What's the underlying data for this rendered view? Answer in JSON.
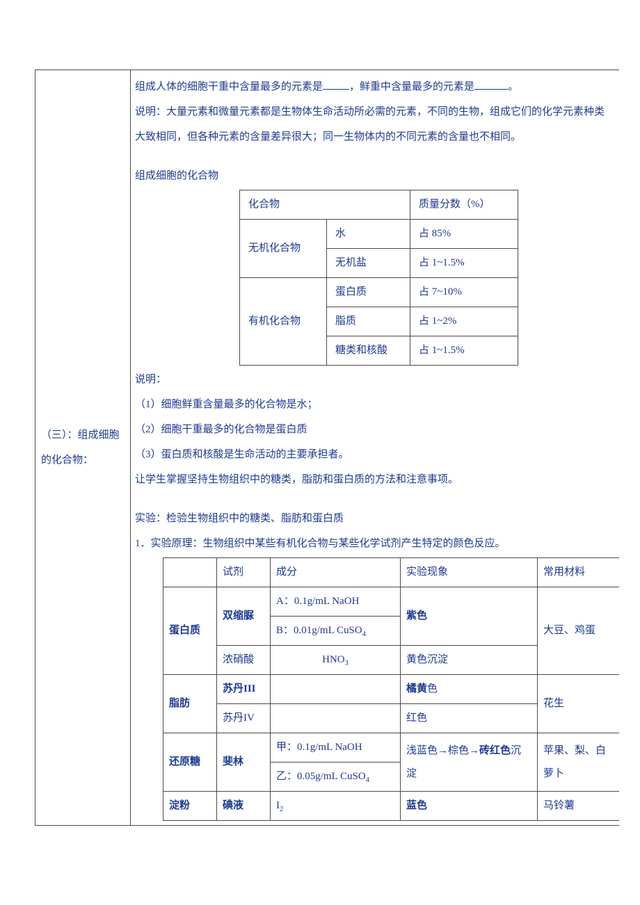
{
  "left_label": "（三）：组成细胞的化合物：",
  "intro": {
    "line1_a": "组成人体的细胞干重中含量最多的元素是",
    "line1_b": "，鲜重中含量最多的元素是",
    "line1_c": "。",
    "line2": "说明：大量元素和微量元素都是生物体生命活动所必需的元素，不同的生物，组成它们的化学元素种类大致相同，但各种元素的含量差异很大；同一生物体内的不同元素的含量也不相同。"
  },
  "section2_title": "组成细胞的化合物",
  "table1": {
    "h1": "化合物",
    "h2": "质量分数（%）",
    "c1": "无机化合物",
    "c2": "有机化合物",
    "r1a": "水",
    "r1b": "占 85%",
    "r2a": "无机盐",
    "r2b": "占 1~1.5%",
    "r3a": "蛋白质",
    "r3b": "占 7~10%",
    "r4a": "脂质",
    "r4b": "占 1~2%",
    "r5a": "糖类和核酸",
    "r5b": "占 1~1.5%"
  },
  "notes": {
    "t": "说明：",
    "n1": "（1）细胞鲜重含量最多的化合物是水；",
    "n2": "（2）细胞干重最多的化合物是蛋白质",
    "n3": "（3）蛋白质和核酸是生命活动的主要承担者。",
    "n4": "让学生掌握坚持生物组织中的糖类，脂肪和蛋白质的方法和注意事项。"
  },
  "exp": {
    "title": "实验：检验生物组织中的糖类、脂肪和蛋白质",
    "principle": "1．实验原理：生物组织中某些有机化合物与某些化学试剂产生特定的颜色反应。"
  },
  "table2": {
    "h1": "",
    "h2": "试剂",
    "h3": "成分",
    "h4": "实验现象",
    "h5": "常用材料",
    "r1c1": "蛋白质",
    "r1c2": "双缩脲",
    "r1c3a": "A：0.1g/mL  NaOH",
    "r1c3b": "B：0.01g/mL CuSO",
    "r1c4": "紫色",
    "r1c5": "大豆、鸡蛋",
    "r2c2": "浓硝酸",
    "r2c3_pre": "HNO",
    "r2c4": "黄色沉淀",
    "r3c1": "脂肪",
    "r3c2": "苏丹III",
    "r3c4a": "橘黄",
    "r3c4b": "色",
    "r4c2": "苏丹IV",
    "r4c4": "红色",
    "r3c5": "花生",
    "r5c1": "还原糖",
    "r5c2": "斐林",
    "r5c3a": "甲：0.1g/mL  NaOH",
    "r5c3b": "乙：0.05g/mL CuSO",
    "r5c4a": "浅蓝色→棕色→",
    "r5c4b": "砖红色",
    "r5c4c": "沉淀",
    "r5c5": "苹果、梨、白萝卜",
    "r6c1": "淀粉",
    "r6c2": "碘液",
    "r6c3": "I",
    "r6c4": "蓝色",
    "r6c5": "马铃薯"
  }
}
